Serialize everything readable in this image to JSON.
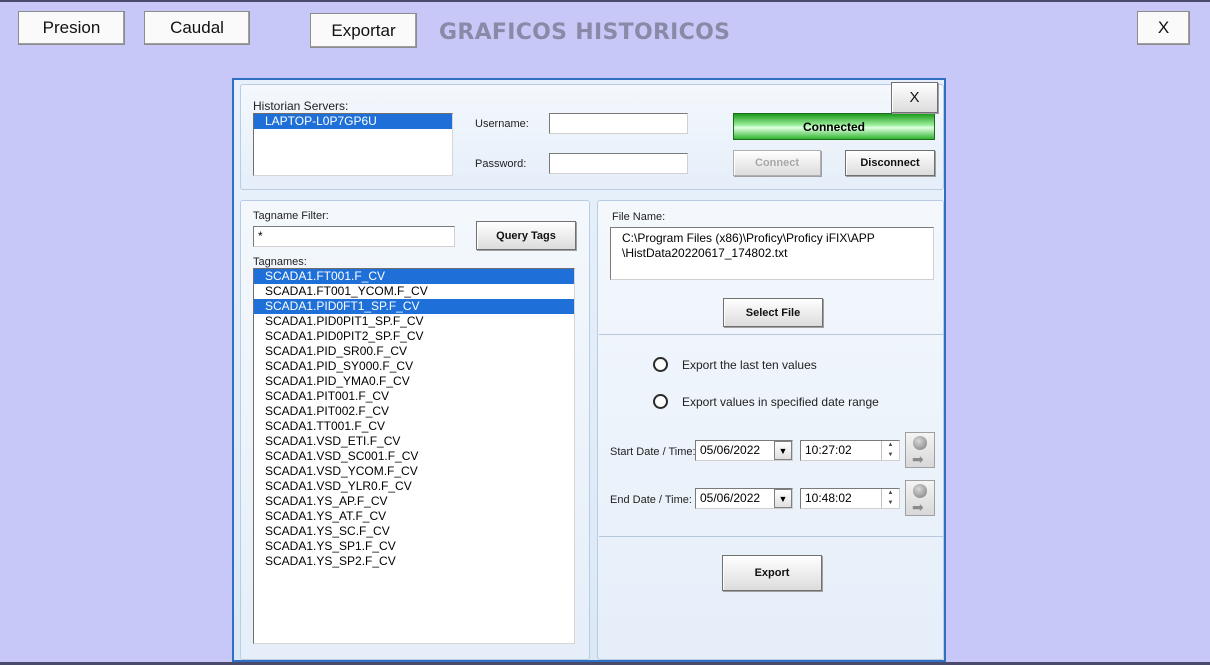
{
  "toolbar": {
    "presion_label": "Presion",
    "caudal_label": "Caudal",
    "exportar_label": "Exportar",
    "title": "GRAFICOS HISTORICOS",
    "close_label": "X"
  },
  "dialog": {
    "close_label": "X",
    "servers": {
      "label": "Historian Servers:",
      "items": [
        "LAPTOP-L0P7GP6U"
      ],
      "username_label": "Username:",
      "username_value": "",
      "password_label": "Password:",
      "password_value": "",
      "status": "Connected",
      "connect_label": "Connect",
      "disconnect_label": "Disconnect"
    },
    "tags": {
      "filter_label": "Tagname Filter:",
      "filter_value": "*",
      "query_label": "Query Tags",
      "tagnames_label": "Tagnames:",
      "items": [
        {
          "name": "SCADA1.FT001.F_CV",
          "selected": true
        },
        {
          "name": "SCADA1.FT001_YCOM.F_CV",
          "selected": false
        },
        {
          "name": "SCADA1.PID0FT1_SP.F_CV",
          "selected": true
        },
        {
          "name": "SCADA1.PID0PIT1_SP.F_CV",
          "selected": false
        },
        {
          "name": "SCADA1.PID0PIT2_SP.F_CV",
          "selected": false
        },
        {
          "name": "SCADA1.PID_SR00.F_CV",
          "selected": false
        },
        {
          "name": "SCADA1.PID_SY000.F_CV",
          "selected": false
        },
        {
          "name": "SCADA1.PID_YMA0.F_CV",
          "selected": false
        },
        {
          "name": "SCADA1.PIT001.F_CV",
          "selected": false
        },
        {
          "name": "SCADA1.PIT002.F_CV",
          "selected": false
        },
        {
          "name": "SCADA1.TT001.F_CV",
          "selected": false
        },
        {
          "name": "SCADA1.VSD_ETI.F_CV",
          "selected": false
        },
        {
          "name": "SCADA1.VSD_SC001.F_CV",
          "selected": false
        },
        {
          "name": "SCADA1.VSD_YCOM.F_CV",
          "selected": false
        },
        {
          "name": "SCADA1.VSD_YLR0.F_CV",
          "selected": false
        },
        {
          "name": "SCADA1.YS_AP.F_CV",
          "selected": false
        },
        {
          "name": "SCADA1.YS_AT.F_CV",
          "selected": false
        },
        {
          "name": "SCADA1.YS_SC.F_CV",
          "selected": false
        },
        {
          "name": "SCADA1.YS_SP1.F_CV",
          "selected": false
        },
        {
          "name": "SCADA1.YS_SP2.F_CV",
          "selected": false
        }
      ]
    },
    "file": {
      "label": "File Name:",
      "line1": "C:\\Program Files (x86)\\Proficy\\Proficy iFIX\\APP",
      "line2": "\\HistData20220617_174802.txt",
      "select_label": "Select File"
    },
    "export": {
      "option_last_ten": "Export the last ten values",
      "option_range": "Export values in specified date range",
      "start_label": "Start Date / Time:",
      "start_date": "05/06/2022",
      "start_time": "10:27:02",
      "end_label": "End Date / Time:",
      "end_date": "05/06/2022",
      "end_time": "10:48:02",
      "export_label": "Export"
    }
  },
  "icons": {
    "combo_arrow": "chevron-down-icon",
    "spin": "spin-arrows-icon",
    "now_button": "set-now-icon"
  }
}
